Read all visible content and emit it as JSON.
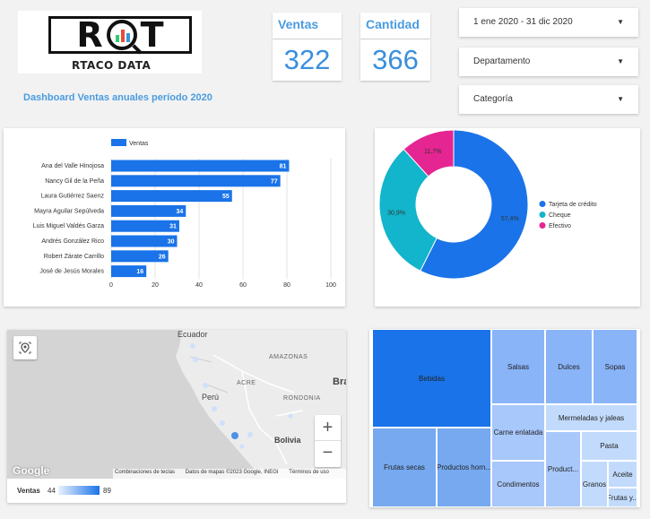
{
  "logo": {
    "mark_left": "R",
    "mark_right": "T",
    "subtitle": "RTACO DATA"
  },
  "dashboard_title": "Dashboard Ventas anuales período 2020",
  "kpis": [
    {
      "label": "Ventas",
      "value": "322"
    },
    {
      "label": "Cantidad",
      "value": "366"
    }
  ],
  "filters": [
    {
      "label": "1 ene 2020 - 31 dic 2020"
    },
    {
      "label": "Departamento"
    },
    {
      "label": "Categoría"
    }
  ],
  "colors": {
    "accent": "#4a9be0",
    "bar": "#1a73e8",
    "donut_tarjeta": "#1a73e8",
    "donut_cheque": "#12b5cb",
    "donut_efectivo": "#e52592"
  },
  "chart_data": [
    {
      "type": "bar",
      "orientation": "horizontal",
      "legend": [
        "Ventas"
      ],
      "categories": [
        "Ana del Valle Hinojosa",
        "Nancy Gil de la Peña",
        "Laura Gutiérrez Saenz",
        "Mayra Aguilar Sepúlveda",
        "Luis Miguel Valdés Garza",
        "Andrés González Rico",
        "Robert Zárate Carrillo",
        "José de Jesús Morales"
      ],
      "series": [
        {
          "name": "Ventas",
          "values": [
            81,
            77,
            55,
            34,
            31,
            30,
            26,
            16
          ]
        }
      ],
      "xlim": [
        0,
        100
      ],
      "xticks": [
        "0",
        "20",
        "40",
        "60",
        "80",
        "100"
      ],
      "grid": true,
      "legend_position": "top"
    },
    {
      "type": "pie",
      "donut": true,
      "slices": [
        {
          "label": "Tarjeta de crédito",
          "value": 57.4,
          "display": "57,4%"
        },
        {
          "label": "Cheque",
          "value": 30.9,
          "display": "30,9%"
        },
        {
          "label": "Efectivo",
          "value": 11.7,
          "display": "11,7%"
        }
      ],
      "legend_position": "right"
    },
    {
      "type": "heatmap",
      "kind": "treemap",
      "tiles": [
        {
          "label": "Bebidas",
          "color": "#1a73e8"
        },
        {
          "label": "Salsas",
          "color": "#8ab4f8"
        },
        {
          "label": "Dulces",
          "color": "#8ab4f8"
        },
        {
          "label": "Sopas",
          "color": "#8ab4f8"
        },
        {
          "label": "Carne enlatada",
          "color": "#a8c7fa"
        },
        {
          "label": "Mermeladas y jaleas",
          "color": "#c2dbfc"
        },
        {
          "label": "Frutas secas",
          "color": "#76a9f0"
        },
        {
          "label": "Productos horn...",
          "color": "#76a9f0"
        },
        {
          "label": "Condimentos",
          "color": "#a8c7fa"
        },
        {
          "label": "Product...",
          "color": "#a8c7fa"
        },
        {
          "label": "Pasta",
          "color": "#c2dbfc"
        },
        {
          "label": "Granos",
          "color": "#c2dbfc"
        },
        {
          "label": "Aceite",
          "color": "#c2dbfc"
        },
        {
          "label": "Frutas y...",
          "color": "#c2dbfc"
        }
      ]
    }
  ],
  "map": {
    "labels": {
      "ecuador": "Ecuador",
      "peru": "Perú",
      "bolivia": "Bolivia",
      "amazonas": "AMAZONAS",
      "acre": "ACRE",
      "rondonia": "RONDONIA",
      "br": "Bra"
    },
    "google": "Google",
    "footer": {
      "shortcuts": "Combinaciones de teclas",
      "data": "Datos de mapas ©2023 Google, INEGI",
      "terms": "Términos de uso"
    },
    "zoom_in": "+",
    "zoom_out": "−",
    "legend": {
      "label": "Ventas",
      "min": "44",
      "max": "89"
    }
  }
}
